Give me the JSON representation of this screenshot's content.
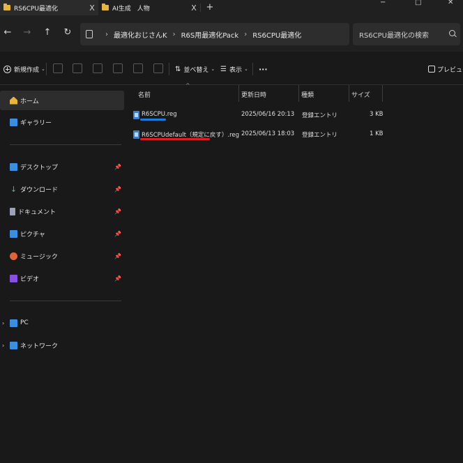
{
  "tabs": [
    {
      "label": "RS6CPU最適化",
      "close": "X"
    },
    {
      "label": "AI生成　人物",
      "close": "X"
    }
  ],
  "new_tab": "+",
  "window": {
    "minimize": "−",
    "maximize": "□",
    "close": "✕"
  },
  "nav": {
    "back": "←",
    "forward": "→",
    "up": "↑",
    "refresh": "↻"
  },
  "breadcrumb": {
    "separator": "›",
    "items": [
      "最適化おじさんK",
      "R6S用最適化Pack",
      "RS6CPU最適化"
    ]
  },
  "search": {
    "placeholder": "RS6CPU最適化の検索"
  },
  "commands": {
    "new": "新規作成",
    "sort": "並べ替え",
    "view": "表示",
    "more": "···",
    "preview": "プレビュー"
  },
  "sidebar": {
    "quick": [
      {
        "label": "ホーム",
        "icon": "home-icon",
        "color": "#e8b43a"
      },
      {
        "label": "ギャラリー",
        "icon": "gallery-icon",
        "color": "#3b8ee0"
      }
    ],
    "pinned": [
      {
        "label": "デスクトップ",
        "icon": "desktop-icon",
        "color": "#3b8ee0"
      },
      {
        "label": "ダウンロード",
        "icon": "download-icon",
        "color": "#3fbf8a"
      },
      {
        "label": "ドキュメント",
        "icon": "documents-icon",
        "color": "#9aa4b5"
      },
      {
        "label": "ピクチャ",
        "icon": "pictures-icon",
        "color": "#3b8ee0"
      },
      {
        "label": "ミュージック",
        "icon": "music-icon",
        "color": "#e0643b"
      },
      {
        "label": "ビデオ",
        "icon": "videos-icon",
        "color": "#8a4fe0"
      }
    ],
    "devices": [
      {
        "label": "PC",
        "icon": "pc-icon",
        "color": "#3b8ee0"
      },
      {
        "label": "ネットワーク",
        "icon": "network-icon",
        "color": "#3b8ee0"
      }
    ]
  },
  "columns": {
    "name": "名前",
    "modified": "更新日時",
    "type": "種類",
    "size": "サイズ",
    "sort_indicator": "^"
  },
  "files": [
    {
      "name": "R6SCPU.reg",
      "modified": "2025/06/16 20:13",
      "type": "登録エントリ",
      "size": "3 KB",
      "mark_color": "#1e7be0"
    },
    {
      "name": "R6SCPUdefault（規定に戻す）.reg",
      "modified": "2025/06/13 18:03",
      "type": "登録エントリ",
      "size": "1 KB",
      "mark_color": "#e01b24"
    }
  ]
}
